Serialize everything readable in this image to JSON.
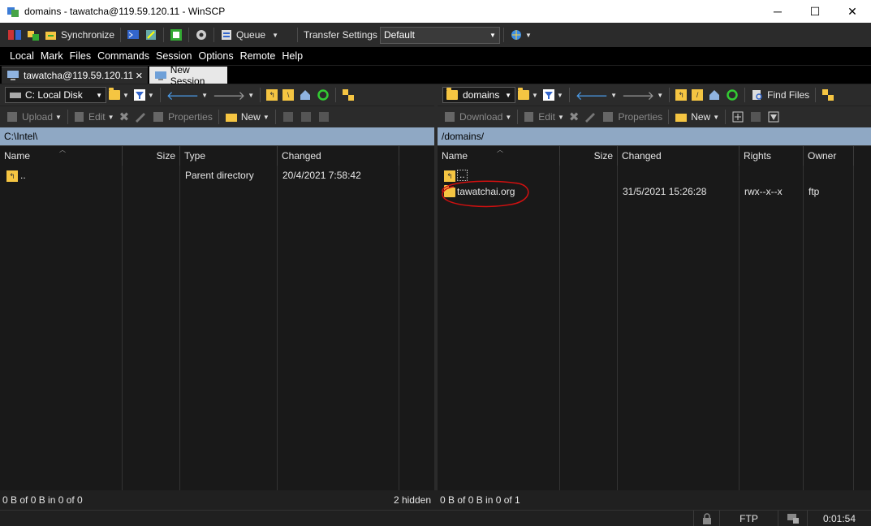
{
  "window": {
    "title": "domains - tawatcha@119.59.120.11 - WinSCP",
    "minimize": "─",
    "maximize": "☐",
    "close": "✕"
  },
  "main_toolbar": {
    "synchronize": "Synchronize",
    "queue": "Queue",
    "transfer_settings_label": "Transfer Settings",
    "transfer_settings_value": "Default"
  },
  "menu": [
    "Local",
    "Mark",
    "Files",
    "Commands",
    "Session",
    "Options",
    "Remote",
    "Help"
  ],
  "tabs": {
    "active": "tawatcha@119.59.120.11",
    "new_session": "New Session"
  },
  "left_panel": {
    "drive": "C: Local Disk",
    "upload": "Upload",
    "edit": "Edit",
    "properties": "Properties",
    "new": "New",
    "path": "C:\\Intel\\",
    "columns": [
      "Name",
      "Size",
      "Type",
      "Changed"
    ],
    "rows": [
      {
        "name": "..",
        "size": "",
        "type": "Parent directory",
        "changed": "20/4/2021  7:58:42"
      }
    ],
    "status": "0 B of 0 B in 0 of 0",
    "hidden": "2 hidden"
  },
  "right_panel": {
    "folder": "domains",
    "download": "Download",
    "edit": "Edit",
    "properties": "Properties",
    "new": "New",
    "find_files": "Find Files",
    "path": "/domains/",
    "columns": [
      "Name",
      "Size",
      "Changed",
      "Rights",
      "Owner"
    ],
    "rows": [
      {
        "name": "..",
        "size": "",
        "changed": "",
        "rights": "",
        "owner": ""
      },
      {
        "name": "tawatchai.org",
        "size": "",
        "changed": "31/5/2021 15:26:28",
        "rights": "rwx--x--x",
        "owner": "ftp"
      }
    ],
    "status": "0 B of 0 B in 0 of 1"
  },
  "statusbar": {
    "protocol": "FTP",
    "time": "0:01:54"
  },
  "colors": {
    "annotation_circle": "#d01010",
    "folder": "#f5c542",
    "path_active": "#8fa8c4"
  },
  "icons": [
    "app-icon",
    "lock-icon",
    "monitor-icon",
    "folder-icon",
    "parent-folder-icon",
    "refresh-icon",
    "home-icon",
    "filter-icon"
  ]
}
